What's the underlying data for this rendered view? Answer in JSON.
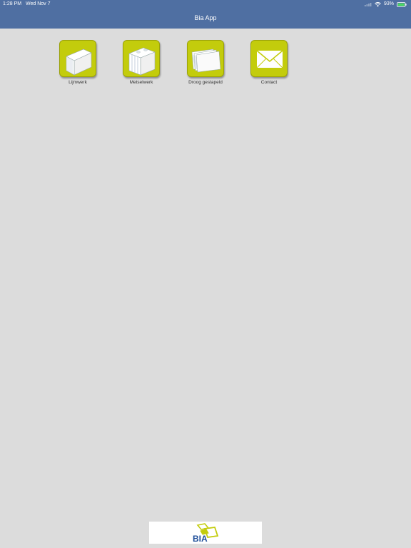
{
  "status": {
    "time": "1:28 PM",
    "date": "Wed Nov 7",
    "battery": "93%"
  },
  "header": {
    "title": "Bia App"
  },
  "tiles": [
    {
      "label": "Lijmwerk",
      "icon": "glue-block-icon"
    },
    {
      "label": "Metselwerk",
      "icon": "masonry-block-icon"
    },
    {
      "label": "Droog gestapeld",
      "icon": "dry-stacked-panels-icon"
    },
    {
      "label": "Contact",
      "icon": "envelope-icon"
    }
  ],
  "footer": {
    "logo_text": "BIA"
  },
  "colors": {
    "header": "#4f6fa2",
    "tile": "#c3cc0c",
    "background": "#dcdcdc",
    "logo_blue": "#1f4f9a"
  }
}
